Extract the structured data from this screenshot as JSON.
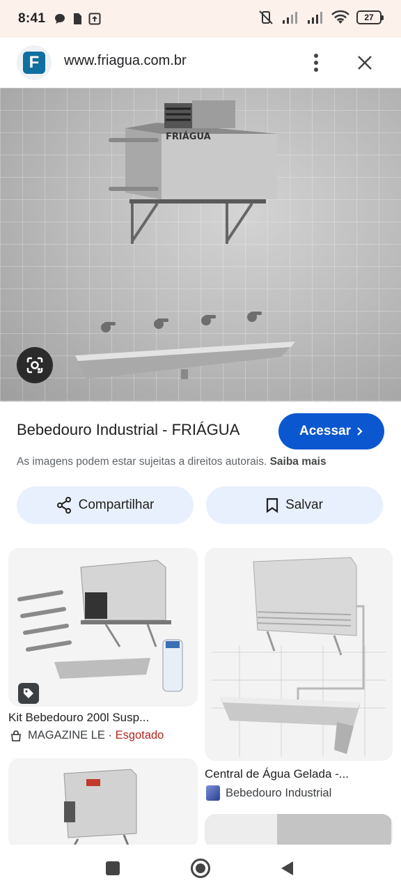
{
  "status_bar": {
    "time": "8:41",
    "battery": "27"
  },
  "browser": {
    "favicon_letter": "F",
    "url": "www.friagua.com.br"
  },
  "hero": {
    "brand_text": "FRIÁGUA"
  },
  "result": {
    "title": "Bebedouro Industrial - FRIÁGUA",
    "visit_label": "Acessar",
    "disclaimer": "As imagens podem estar sujeitas a direitos autorais.",
    "learn_more": "Saiba mais",
    "share_label": "Compartilhar",
    "save_label": "Salvar"
  },
  "related": [
    {
      "title": "Kit Bebedouro 200l Susp...",
      "source": "MAGAZINE LE",
      "separator": " · ",
      "status": "Esgotado"
    },
    {
      "title": "Central de Água Gelada -...",
      "source": "Bebedouro Industrial"
    }
  ],
  "colors": {
    "accent": "#0b57d0",
    "pill_bg": "#e8f0fd",
    "status_bar_bg": "#fdf1ec",
    "sold_out": "#b3261e"
  }
}
